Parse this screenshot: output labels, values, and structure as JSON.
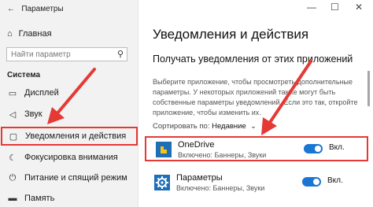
{
  "window": {
    "title": "Параметры",
    "minimize": "—",
    "maximize": "☐",
    "close": "✕"
  },
  "sidebar": {
    "home_label": "Главная",
    "search_placeholder": "Найти параметр",
    "section_label": "Система",
    "items": [
      {
        "label": "Дисплей",
        "icon": "display-icon"
      },
      {
        "label": "Звук",
        "icon": "speaker-icon"
      },
      {
        "label": "Уведомления и действия",
        "icon": "notifications-icon",
        "selected": true
      },
      {
        "label": "Фокусировка внимания",
        "icon": "focus-assist-icon"
      },
      {
        "label": "Питание и спящий режим",
        "icon": "power-icon"
      },
      {
        "label": "Память",
        "icon": "storage-icon"
      }
    ]
  },
  "main": {
    "title": "Уведомления и действия",
    "subtitle": "Получать уведомления от этих приложений",
    "description": "Выберите приложение, чтобы просмотреть дополнительные параметры. У некоторых приложений также могут быть собственные параметры уведомлений. Если это так, откройте приложение, чтобы изменить их.",
    "sort_label": "Сортировать по:",
    "sort_value": "Недавние",
    "apps": [
      {
        "name": "OneDrive",
        "sub": "Включено: Баннеры, Звуки",
        "toggle_label": "Вкл.",
        "toggle_on": true,
        "highlighted": true
      },
      {
        "name": "Параметры",
        "sub": "Включено: Баннеры, Звуки",
        "toggle_label": "Вкл.",
        "toggle_on": true,
        "highlighted": false
      }
    ]
  },
  "colors": {
    "accent": "#1976d2",
    "annotation": "#e53935",
    "sidebar_bg": "#f2f2f2"
  }
}
